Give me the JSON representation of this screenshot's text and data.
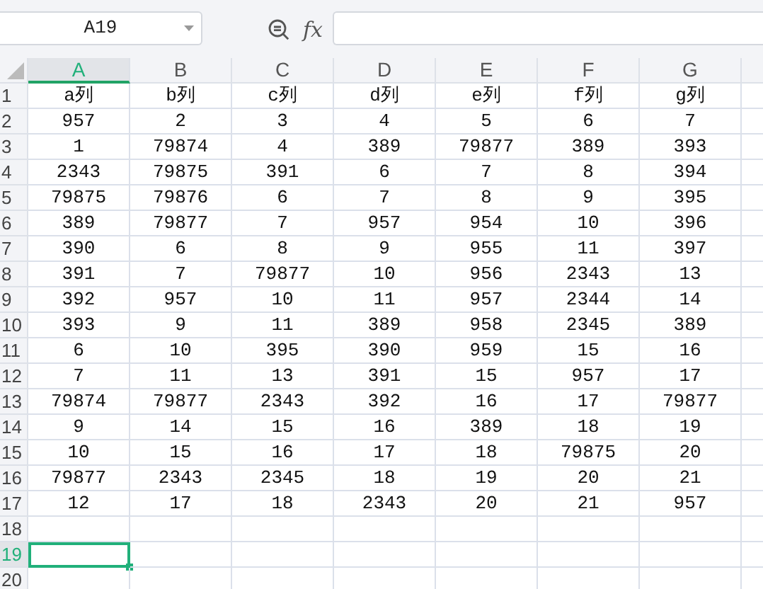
{
  "name_box": {
    "value": "A19"
  },
  "formula_bar": {
    "fx_label": "fx"
  },
  "columns": [
    {
      "label": "A",
      "selected": true
    },
    {
      "label": "B",
      "selected": false
    },
    {
      "label": "C",
      "selected": false
    },
    {
      "label": "D",
      "selected": false
    },
    {
      "label": "E",
      "selected": false
    },
    {
      "label": "F",
      "selected": false
    },
    {
      "label": "G",
      "selected": false
    }
  ],
  "rows": [
    {
      "label": "1",
      "selected": false,
      "cells": [
        "a列",
        "b列",
        "c列",
        "d列",
        "e列",
        "f列",
        "g列"
      ]
    },
    {
      "label": "2",
      "selected": false,
      "cells": [
        "957",
        "2",
        "3",
        "4",
        "5",
        "6",
        "7"
      ]
    },
    {
      "label": "3",
      "selected": false,
      "cells": [
        "1",
        "79874",
        "4",
        "389",
        "79877",
        "389",
        "393"
      ]
    },
    {
      "label": "4",
      "selected": false,
      "cells": [
        "2343",
        "79875",
        "391",
        "6",
        "7",
        "8",
        "394"
      ]
    },
    {
      "label": "5",
      "selected": false,
      "cells": [
        "79875",
        "79876",
        "6",
        "7",
        "8",
        "9",
        "395"
      ]
    },
    {
      "label": "6",
      "selected": false,
      "cells": [
        "389",
        "79877",
        "7",
        "957",
        "954",
        "10",
        "396"
      ]
    },
    {
      "label": "7",
      "selected": false,
      "cells": [
        "390",
        "6",
        "8",
        "9",
        "955",
        "11",
        "397"
      ]
    },
    {
      "label": "8",
      "selected": false,
      "cells": [
        "391",
        "7",
        "79877",
        "10",
        "956",
        "2343",
        "13"
      ]
    },
    {
      "label": "9",
      "selected": false,
      "cells": [
        "392",
        "957",
        "10",
        "11",
        "957",
        "2344",
        "14"
      ]
    },
    {
      "label": "10",
      "selected": false,
      "cells": [
        "393",
        "9",
        "11",
        "389",
        "958",
        "2345",
        "389"
      ]
    },
    {
      "label": "11",
      "selected": false,
      "cells": [
        "6",
        "10",
        "395",
        "390",
        "959",
        "15",
        "16"
      ]
    },
    {
      "label": "12",
      "selected": false,
      "cells": [
        "7",
        "11",
        "13",
        "391",
        "15",
        "957",
        "17"
      ]
    },
    {
      "label": "13",
      "selected": false,
      "cells": [
        "79874",
        "79877",
        "2343",
        "392",
        "16",
        "17",
        "79877"
      ]
    },
    {
      "label": "14",
      "selected": false,
      "cells": [
        "9",
        "14",
        "15",
        "16",
        "389",
        "18",
        "19"
      ]
    },
    {
      "label": "15",
      "selected": false,
      "cells": [
        "10",
        "15",
        "16",
        "17",
        "18",
        "79875",
        "20"
      ]
    },
    {
      "label": "16",
      "selected": false,
      "cells": [
        "79877",
        "2343",
        "2345",
        "18",
        "19",
        "20",
        "21"
      ]
    },
    {
      "label": "17",
      "selected": false,
      "cells": [
        "12",
        "17",
        "18",
        "2343",
        "20",
        "21",
        "957"
      ]
    },
    {
      "label": "18",
      "selected": false
    },
    {
      "label": "19",
      "selected": true
    },
    {
      "label": "20",
      "selected": false
    }
  ]
}
